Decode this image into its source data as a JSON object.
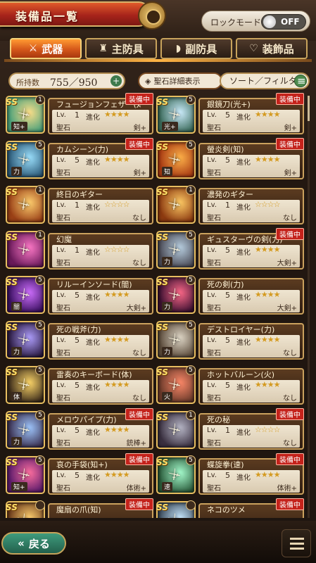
{
  "header": {
    "title": "装備品一覧"
  },
  "lock_mode": {
    "label": "ロックモード",
    "state": "OFF"
  },
  "tabs": [
    {
      "label": "武器",
      "icon": "sword-icon",
      "active": true
    },
    {
      "label": "主防具",
      "icon": "armor-icon",
      "active": false
    },
    {
      "label": "副防具",
      "icon": "shield-icon",
      "active": false
    },
    {
      "label": "装飾品",
      "icon": "accessory-icon",
      "active": false
    }
  ],
  "toolbar": {
    "count_label": "所持数",
    "count_value": "755／950",
    "gem_button": "聖石詳細表示",
    "sort_button": "ソート／フィルタ"
  },
  "items": [
    {
      "name": "フュージョンフェザー(知+)",
      "lv": "1",
      "evo": "3",
      "stars": 5,
      "gem": "剣+",
      "attr": "知+",
      "equipped": true,
      "c1": "#ffe08a",
      "c2": "#4aa07a"
    },
    {
      "name": "銀鏡刀(光+)",
      "lv": "5",
      "evo": "3",
      "stars": 5,
      "gem": "剣+",
      "attr": "光+",
      "equipped": true,
      "c1": "#cfefff",
      "c2": "#3a6a5a"
    },
    {
      "name": "カムシーン(力)",
      "lv": "5",
      "evo": "3",
      "stars": 5,
      "gem": "剣+",
      "attr": "力",
      "equipped": true,
      "c1": "#9de2ff",
      "c2": "#2c5a78"
    },
    {
      "name": "螢炎剣(知)",
      "lv": "5",
      "evo": "3",
      "stars": 5,
      "gem": "剣+",
      "attr": "知",
      "equipped": true,
      "c1": "#ffb34a",
      "c2": "#a83a12"
    },
    {
      "name": "終日のギター",
      "lv": "1",
      "evo": "0",
      "stars": 5,
      "gem": "なし",
      "attr": "",
      "equipped": false,
      "c1": "#ffd070",
      "c2": "#9a4016"
    },
    {
      "name": "濃発のギター",
      "lv": "1",
      "evo": "0",
      "stars": 5,
      "gem": "なし",
      "attr": "",
      "equipped": false,
      "c1": "#ffcc66",
      "c2": "#8c3a10"
    },
    {
      "name": "幻魔",
      "lv": "1",
      "evo": "0",
      "stars": 5,
      "gem": "なし",
      "attr": "",
      "equipped": false,
      "c1": "#ff7ac8",
      "c2": "#6a1a5a"
    },
    {
      "name": "ギュスターヴの剣(力)",
      "lv": "5",
      "evo": "3",
      "stars": 5,
      "gem": "大剣+",
      "attr": "力",
      "equipped": true,
      "c1": "#b9d0e2",
      "c2": "#4a4a55"
    },
    {
      "name": "リルーインソード(闇)",
      "lv": "5",
      "evo": "3",
      "stars": 5,
      "gem": "大剣+",
      "attr": "闇",
      "equipped": false,
      "c1": "#d070ff",
      "c2": "#3a1060"
    },
    {
      "name": "死の剣(力)",
      "lv": "5",
      "evo": "3",
      "stars": 5,
      "gem": "大剣+",
      "attr": "力",
      "equipped": false,
      "c1": "#ff6a8a",
      "c2": "#3a1030"
    },
    {
      "name": "死の戦斧(力)",
      "lv": "5",
      "evo": "3",
      "stars": 5,
      "gem": "なし",
      "attr": "力",
      "equipped": false,
      "c1": "#b0a0ff",
      "c2": "#2a1a40"
    },
    {
      "name": "デストロイヤー(力)",
      "lv": "5",
      "evo": "3",
      "stars": 5,
      "gem": "なし",
      "attr": "力",
      "equipped": false,
      "c1": "#e0d8c8",
      "c2": "#5a4a3a"
    },
    {
      "name": "雷奏のキーボード(体)",
      "lv": "5",
      "evo": "3",
      "stars": 5,
      "gem": "なし",
      "attr": "体",
      "equipped": false,
      "c1": "#ffd86a",
      "c2": "#3a2a1a"
    },
    {
      "name": "ホットバルーン(火)",
      "lv": "5",
      "evo": "3",
      "stars": 5,
      "gem": "なし",
      "attr": "火",
      "equipped": false,
      "c1": "#ff8a6a",
      "c2": "#6a3a2a"
    },
    {
      "name": "メロウパイプ(力)",
      "lv": "5",
      "evo": "3",
      "stars": 5,
      "gem": "銃棒+",
      "attr": "力",
      "equipped": true,
      "c1": "#a0c8ff",
      "c2": "#3a3050"
    },
    {
      "name": "死の秘",
      "lv": "1",
      "evo": "0",
      "stars": 5,
      "gem": "なし",
      "attr": "",
      "equipped": true,
      "c1": "#b8b8c8",
      "c2": "#3a3040"
    },
    {
      "name": "哀の手袋(知+)",
      "lv": "5",
      "evo": "3",
      "stars": 5,
      "gem": "体術+",
      "attr": "知+",
      "equipped": true,
      "c1": "#ff70a0",
      "c2": "#5a1a6a"
    },
    {
      "name": "蝶旋拳(速)",
      "lv": "5",
      "evo": "3",
      "stars": 5,
      "gem": "体術+",
      "attr": "速",
      "equipped": true,
      "c1": "#a8ffd0",
      "c2": "#2a5a3a"
    },
    {
      "name": "魔扇の爪(知)",
      "lv": "",
      "evo": "",
      "stars": 0,
      "gem": "",
      "attr": "",
      "equipped": true,
      "c1": "#ffd070",
      "c2": "#6a3a1a"
    },
    {
      "name": "ネコのツメ",
      "lv": "",
      "evo": "",
      "stars": 0,
      "gem": "",
      "attr": "",
      "equipped": true,
      "c1": "#c8e8ff",
      "c2": "#3a4a5a"
    }
  ],
  "labels": {
    "lv": "Lv.",
    "evo": "進化",
    "gem": "聖石",
    "equipped": "装備中"
  },
  "footer": {
    "back_label": "戻る"
  },
  "colors": {
    "accent": "#d4571a",
    "equipped_badge": "#c4221b",
    "frame_gold": "#caa15d"
  }
}
